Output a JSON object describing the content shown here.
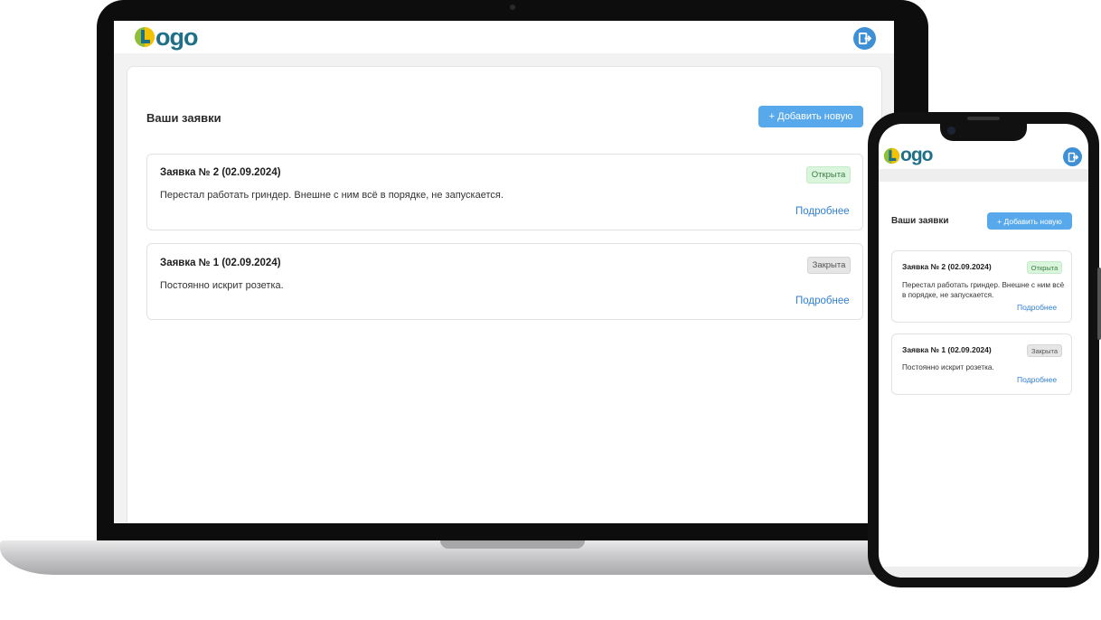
{
  "brand": {
    "logo_text": "ogo",
    "logo_colors": {
      "ring_green": "#8fbf3a",
      "ring_yellow": "#f2c200",
      "text": "#1f6f86"
    }
  },
  "header": {
    "logout_icon": "logout-icon",
    "logout_color": "#3d8fd6"
  },
  "page": {
    "title": "Ваши заявки",
    "add_button": "+ Добавить новую"
  },
  "requests": [
    {
      "title": "Заявка № 2 (02.09.2024)",
      "description": "Перестал работать гриндер. Внешне с ним всё в порядке, не запускается.",
      "status": "Открыта",
      "link": "Подробнее"
    },
    {
      "title": "Заявка № 1 (02.09.2024)",
      "description": "Постоянно искрит розетка.",
      "status": "Закрыта",
      "link": "Подробнее"
    }
  ]
}
